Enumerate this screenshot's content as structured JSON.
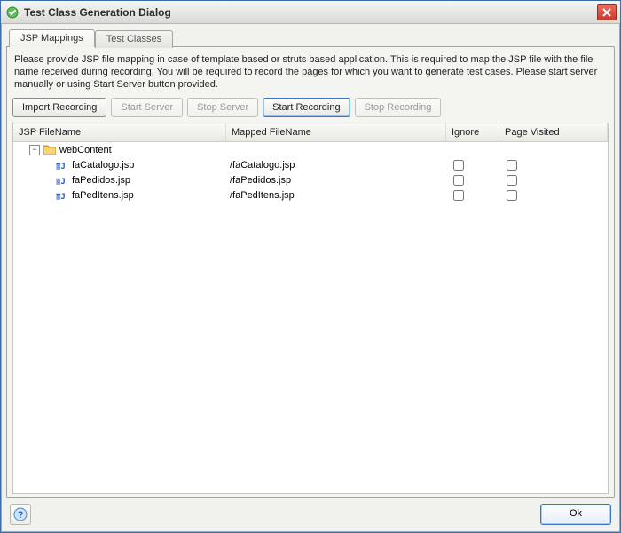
{
  "window": {
    "title": "Test Class Generation Dialog"
  },
  "tabs": [
    {
      "label": "JSP Mappings",
      "active": true
    },
    {
      "label": "Test Classes",
      "active": false
    }
  ],
  "description": "Please provide JSP file mapping in case of template based or struts based application. This is required to map the JSP file with the file name received during recording. You will be required to record the pages for which you want to generate test cases. Please start server manually or using Start Server button provided.",
  "toolbar": {
    "import_recording": "Import Recording",
    "start_server": "Start Server",
    "stop_server": "Stop Server",
    "start_recording": "Start Recording",
    "stop_recording": "Stop Recording"
  },
  "columns": {
    "file": "JSP FileName",
    "mapped": "Mapped FileName",
    "ignore": "Ignore",
    "visited": "Page Visited"
  },
  "tree": {
    "root": {
      "label": "webContent",
      "expanded": true
    },
    "rows": [
      {
        "file": "faCatalogo.jsp",
        "mapped": "/faCatalogo.jsp",
        "ignore": false,
        "visited": false
      },
      {
        "file": "faPedidos.jsp",
        "mapped": "/faPedidos.jsp",
        "ignore": false,
        "visited": false
      },
      {
        "file": "faPedItens.jsp",
        "mapped": "/faPedItens.jsp",
        "ignore": false,
        "visited": false
      }
    ]
  },
  "footer": {
    "ok": "Ok"
  }
}
